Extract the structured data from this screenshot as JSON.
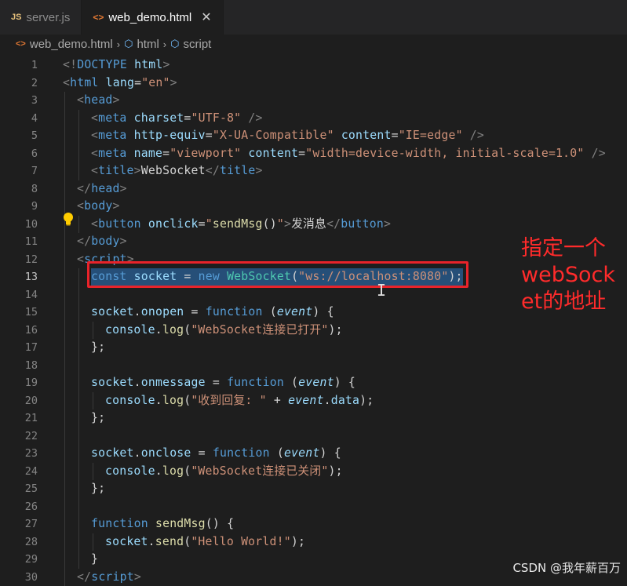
{
  "tabs": [
    {
      "icon": "JS",
      "label": "server.js",
      "active": false
    },
    {
      "icon": "<>",
      "label": "web_demo.html",
      "active": true,
      "close": "✕"
    }
  ],
  "breadcrumb": {
    "file": "web_demo.html",
    "items": [
      "html",
      "script"
    ]
  },
  "editor": {
    "current_line": 13,
    "lines": [
      {
        "n": 1,
        "indent": 0,
        "tokens": [
          [
            "punc",
            "<!"
          ],
          [
            "doc",
            "DOCTYPE"
          ],
          [
            "attr",
            " html"
          ],
          [
            "punc",
            ">"
          ]
        ]
      },
      {
        "n": 2,
        "indent": 0,
        "tokens": [
          [
            "punc",
            "<"
          ],
          [
            "tag",
            "html"
          ],
          [
            "attr",
            " lang"
          ],
          [
            "text",
            "="
          ],
          [
            "str",
            "\"en\""
          ],
          [
            "punc",
            ">"
          ]
        ]
      },
      {
        "n": 3,
        "indent": 1,
        "tokens": [
          [
            "punc",
            "<"
          ],
          [
            "tag",
            "head"
          ],
          [
            "punc",
            ">"
          ]
        ]
      },
      {
        "n": 4,
        "indent": 2,
        "tokens": [
          [
            "punc",
            "<"
          ],
          [
            "tag",
            "meta"
          ],
          [
            "attr",
            " charset"
          ],
          [
            "text",
            "="
          ],
          [
            "str",
            "\"UTF-8\""
          ],
          [
            "punc",
            " />"
          ]
        ]
      },
      {
        "n": 5,
        "indent": 2,
        "tokens": [
          [
            "punc",
            "<"
          ],
          [
            "tag",
            "meta"
          ],
          [
            "attr",
            " http-equiv"
          ],
          [
            "text",
            "="
          ],
          [
            "str",
            "\"X-UA-Compatible\""
          ],
          [
            "attr",
            " content"
          ],
          [
            "text",
            "="
          ],
          [
            "str",
            "\"IE=edge\""
          ],
          [
            "punc",
            " />"
          ]
        ]
      },
      {
        "n": 6,
        "indent": 2,
        "tokens": [
          [
            "punc",
            "<"
          ],
          [
            "tag",
            "meta"
          ],
          [
            "attr",
            " name"
          ],
          [
            "text",
            "="
          ],
          [
            "str",
            "\"viewport\""
          ],
          [
            "attr",
            " content"
          ],
          [
            "text",
            "="
          ],
          [
            "str",
            "\"width=device-width, initial-scale=1.0\""
          ],
          [
            "punc",
            " />"
          ]
        ]
      },
      {
        "n": 7,
        "indent": 2,
        "tokens": [
          [
            "punc",
            "<"
          ],
          [
            "tag",
            "title"
          ],
          [
            "punc",
            ">"
          ],
          [
            "text",
            "WebSocket"
          ],
          [
            "punc",
            "</"
          ],
          [
            "tag",
            "title"
          ],
          [
            "punc",
            ">"
          ]
        ]
      },
      {
        "n": 8,
        "indent": 1,
        "tokens": [
          [
            "punc",
            "</"
          ],
          [
            "tag",
            "head"
          ],
          [
            "punc",
            ">"
          ]
        ]
      },
      {
        "n": 9,
        "indent": 1,
        "tokens": [
          [
            "punc",
            "<"
          ],
          [
            "tag",
            "body"
          ],
          [
            "punc",
            ">"
          ]
        ]
      },
      {
        "n": 10,
        "indent": 2,
        "tokens": [
          [
            "punc",
            "<"
          ],
          [
            "tag",
            "button"
          ],
          [
            "attr",
            " onclick"
          ],
          [
            "text",
            "="
          ],
          [
            "str",
            "\""
          ],
          [
            "fn",
            "sendMsg"
          ],
          [
            "text",
            "()"
          ],
          [
            "str",
            "\""
          ],
          [
            "punc",
            ">"
          ],
          [
            "text",
            "发消息"
          ],
          [
            "punc",
            "</"
          ],
          [
            "tag",
            "button"
          ],
          [
            "punc",
            ">"
          ]
        ]
      },
      {
        "n": 11,
        "indent": 1,
        "tokens": [
          [
            "punc",
            "</"
          ],
          [
            "tag",
            "body"
          ],
          [
            "punc",
            ">"
          ]
        ]
      },
      {
        "n": 12,
        "indent": 1,
        "tokens": [
          [
            "punc",
            "<"
          ],
          [
            "tag",
            "script"
          ],
          [
            "punc",
            ">"
          ]
        ]
      },
      {
        "n": 13,
        "indent": 2,
        "tokens": [
          [
            "key",
            "const"
          ],
          [
            "text",
            " "
          ],
          [
            "var",
            "socket"
          ],
          [
            "text",
            " = "
          ],
          [
            "key",
            "new"
          ],
          [
            "text",
            " "
          ],
          [
            "cls",
            "WebSocket"
          ],
          [
            "text",
            "("
          ],
          [
            "str",
            "\"ws://localhost:8080\""
          ],
          [
            "text",
            ");"
          ]
        ]
      },
      {
        "n": 14,
        "indent": 2,
        "tokens": []
      },
      {
        "n": 15,
        "indent": 2,
        "tokens": [
          [
            "var",
            "socket"
          ],
          [
            "text",
            "."
          ],
          [
            "var",
            "onopen"
          ],
          [
            "text",
            " = "
          ],
          [
            "key",
            "function"
          ],
          [
            "text",
            " ("
          ],
          [
            "param",
            "event"
          ],
          [
            "text",
            ") {"
          ]
        ]
      },
      {
        "n": 16,
        "indent": 3,
        "tokens": [
          [
            "var",
            "console"
          ],
          [
            "text",
            "."
          ],
          [
            "fn",
            "log"
          ],
          [
            "text",
            "("
          ],
          [
            "str",
            "\"WebSocket连接已打开\""
          ],
          [
            "text",
            ");"
          ]
        ]
      },
      {
        "n": 17,
        "indent": 2,
        "tokens": [
          [
            "text",
            "};"
          ]
        ]
      },
      {
        "n": 18,
        "indent": 2,
        "tokens": []
      },
      {
        "n": 19,
        "indent": 2,
        "tokens": [
          [
            "var",
            "socket"
          ],
          [
            "text",
            "."
          ],
          [
            "var",
            "onmessage"
          ],
          [
            "text",
            " = "
          ],
          [
            "key",
            "function"
          ],
          [
            "text",
            " ("
          ],
          [
            "param",
            "event"
          ],
          [
            "text",
            ") {"
          ]
        ]
      },
      {
        "n": 20,
        "indent": 3,
        "tokens": [
          [
            "var",
            "console"
          ],
          [
            "text",
            "."
          ],
          [
            "fn",
            "log"
          ],
          [
            "text",
            "("
          ],
          [
            "str",
            "\"收到回复: \""
          ],
          [
            "text",
            " + "
          ],
          [
            "param",
            "event"
          ],
          [
            "text",
            "."
          ],
          [
            "var",
            "data"
          ],
          [
            "text",
            ");"
          ]
        ]
      },
      {
        "n": 21,
        "indent": 2,
        "tokens": [
          [
            "text",
            "};"
          ]
        ]
      },
      {
        "n": 22,
        "indent": 2,
        "tokens": []
      },
      {
        "n": 23,
        "indent": 2,
        "tokens": [
          [
            "var",
            "socket"
          ],
          [
            "text",
            "."
          ],
          [
            "var",
            "onclose"
          ],
          [
            "text",
            " = "
          ],
          [
            "key",
            "function"
          ],
          [
            "text",
            " ("
          ],
          [
            "param",
            "event"
          ],
          [
            "text",
            ") {"
          ]
        ]
      },
      {
        "n": 24,
        "indent": 3,
        "tokens": [
          [
            "var",
            "console"
          ],
          [
            "text",
            "."
          ],
          [
            "fn",
            "log"
          ],
          [
            "text",
            "("
          ],
          [
            "str",
            "\"WebSocket连接已关闭\""
          ],
          [
            "text",
            ");"
          ]
        ]
      },
      {
        "n": 25,
        "indent": 2,
        "tokens": [
          [
            "text",
            "};"
          ]
        ]
      },
      {
        "n": 26,
        "indent": 2,
        "tokens": []
      },
      {
        "n": 27,
        "indent": 2,
        "tokens": [
          [
            "key",
            "function"
          ],
          [
            "text",
            " "
          ],
          [
            "fn",
            "sendMsg"
          ],
          [
            "text",
            "() {"
          ]
        ]
      },
      {
        "n": 28,
        "indent": 3,
        "tokens": [
          [
            "var",
            "socket"
          ],
          [
            "text",
            "."
          ],
          [
            "fn",
            "send"
          ],
          [
            "text",
            "("
          ],
          [
            "str",
            "\"Hello World!\""
          ],
          [
            "text",
            ");"
          ]
        ]
      },
      {
        "n": 29,
        "indent": 2,
        "tokens": [
          [
            "text",
            "}"
          ]
        ]
      },
      {
        "n": 30,
        "indent": 1,
        "tokens": [
          [
            "punc",
            "</"
          ],
          [
            "tag",
            "script"
          ],
          [
            "punc",
            ">"
          ]
        ]
      }
    ]
  },
  "annotation": "指定一个webSocket的地址",
  "watermark": "CSDN @我年薪百万",
  "colors": {
    "highlight_border": "#e8232a",
    "annotation": "#ff2b2b",
    "selection": "#264f78"
  }
}
